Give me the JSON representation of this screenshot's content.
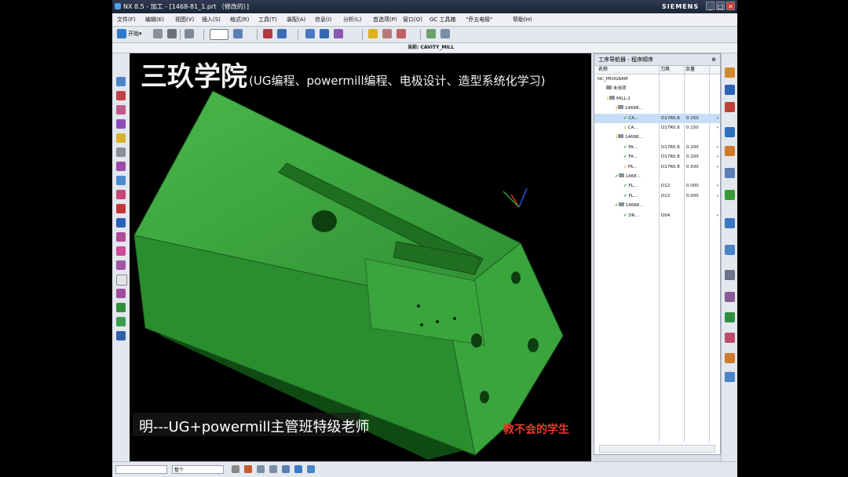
{
  "titlebar": {
    "title": "NX 8.5 - 加工 - [1468-81_1.prt （修改的）]",
    "brand": "SIEMENS"
  },
  "menu": {
    "items": [
      "文件(F)",
      "编辑(E)",
      "视图(V)",
      "插入(S)",
      "格式(R)",
      "工具(T)",
      "装配(A)",
      "信息(I)",
      "分析(L)",
      "首选项(P)",
      "窗口(O)",
      "GC 工具箱",
      "\"乔五电极\"",
      "帮助(H)"
    ]
  },
  "toolbar": {
    "start_label": "开始▾"
  },
  "statusline": {
    "current": "当前: CAVITY_MILL"
  },
  "viewport": {
    "watermark_title": "三玖学院",
    "watermark_subtitle": "(UG编程、powermill编程、电极设计、造型系统化学习)",
    "teacher_caption": "明---UG+powermill主管班特级老师",
    "red_caption": "教不会的学生"
  },
  "navigator": {
    "title": "工序导航器 - 程序顺序",
    "columns": [
      "名称",
      "刀具",
      "余量"
    ],
    "rows": [
      {
        "name": "NC_PROGRAM",
        "tool": "",
        "stock": "",
        "indent": 0,
        "icon": "none"
      },
      {
        "name": "未用项",
        "tool": "",
        "stock": "",
        "indent": 1,
        "icon": "folder"
      },
      {
        "name": "MILL-2",
        "tool": "",
        "stock": "",
        "indent": 1,
        "icon": "key-folder"
      },
      {
        "name": "14688...",
        "tool": "",
        "stock": "",
        "indent": 2,
        "icon": "key-folder"
      },
      {
        "name": "CA...",
        "tool": "D17R0.8",
        "stock": "0.150",
        "indent": 3,
        "icon": "check",
        "sel": true
      },
      {
        "name": "CA...",
        "tool": "D17R0.8",
        "stock": "0.150",
        "indent": 3,
        "icon": "key"
      },
      {
        "name": "14688...",
        "tool": "",
        "stock": "",
        "indent": 2,
        "icon": "key-folder"
      },
      {
        "name": "FA...",
        "tool": "D17R0.8",
        "stock": "0.200",
        "indent": 3,
        "icon": "check"
      },
      {
        "name": "FA...",
        "tool": "D17R0.8",
        "stock": "0.200",
        "indent": 3,
        "icon": "check"
      },
      {
        "name": "FA...",
        "tool": "D17R0.8",
        "stock": "0.500",
        "indent": 3,
        "icon": "key"
      },
      {
        "name": "1468...",
        "tool": "",
        "stock": "",
        "indent": 2,
        "icon": "check-folder"
      },
      {
        "name": "PL...",
        "tool": "D12",
        "stock": "0.000",
        "indent": 3,
        "icon": "check"
      },
      {
        "name": "PL...",
        "tool": "D12",
        "stock": "0.000",
        "indent": 3,
        "icon": "check"
      },
      {
        "name": "14688...",
        "tool": "",
        "stock": "",
        "indent": 2,
        "icon": "check-folder"
      },
      {
        "name": "DR...",
        "tool": "D04",
        "stock": "",
        "indent": 3,
        "icon": "check"
      }
    ]
  },
  "bottombar": {
    "combo1": "",
    "combo2": "整个"
  }
}
